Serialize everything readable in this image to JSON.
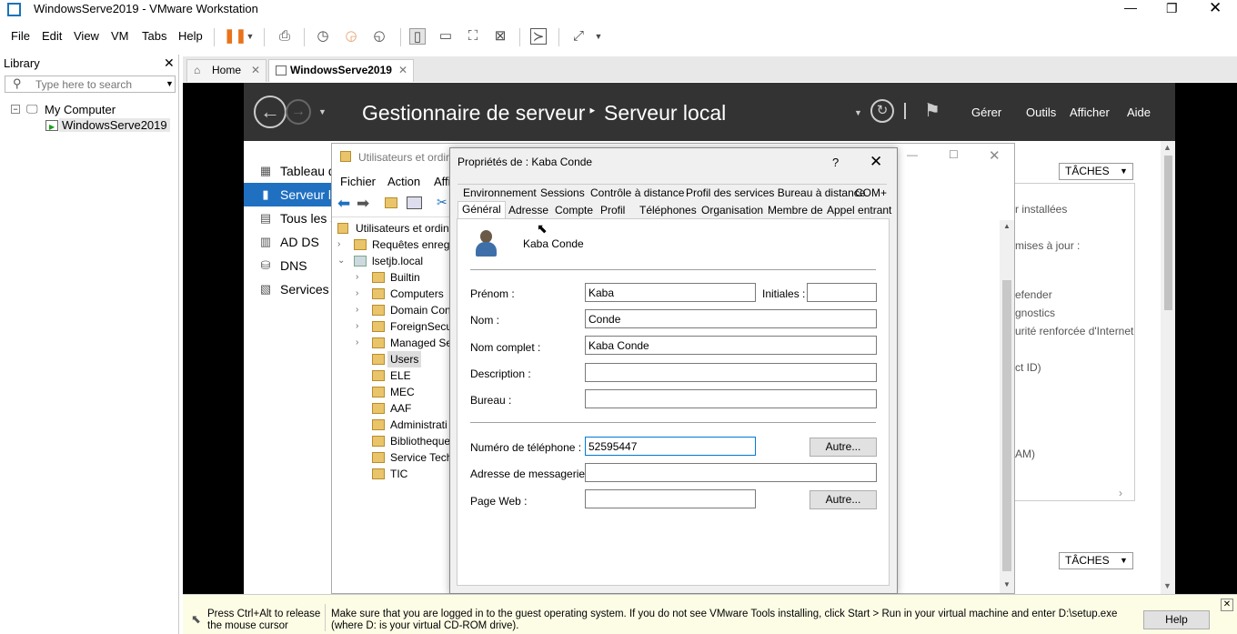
{
  "window": {
    "title": "WindowsServe2019 - VMware Workstation"
  },
  "menubar": {
    "items": [
      "File",
      "Edit",
      "View",
      "VM",
      "Tabs",
      "Help"
    ]
  },
  "library": {
    "title": "Library",
    "search_placeholder": "Type here to search",
    "tree": {
      "root": "My Computer",
      "child": "WindowsServe2019"
    }
  },
  "tabs": [
    {
      "label": "Home"
    },
    {
      "label": "WindowsServe2019"
    }
  ],
  "server_manager": {
    "breadcrumb_root": "Gestionnaire de serveur",
    "breadcrumb_sep": "‣",
    "breadcrumb_page": "Serveur local",
    "menu": [
      "Gérer",
      "Outils",
      "Afficher",
      "Aide"
    ],
    "nav": [
      "Tableau d",
      "Serveur lo",
      "Tous les s",
      "AD DS",
      "DNS",
      "Services d"
    ],
    "tasks_label": "TÂCHES",
    "right_texts": [
      "r installées",
      "mises à jour :",
      "efender",
      "gnostics",
      "urité renforcée d'Internet",
      "ct ID)",
      "AM)"
    ]
  },
  "aduc": {
    "title": "Utilisateurs et ordin",
    "menu": [
      "Fichier",
      "Action",
      "Affi"
    ],
    "tree": {
      "root": "Utilisateurs et ordina",
      "saved": "Requêtes enregi",
      "domain": "lsetjb.local",
      "nodes": [
        "Builtin",
        "Computers",
        "Domain Con",
        "ForeignSecu",
        "Managed Se",
        "Users",
        "ELE",
        "MEC",
        "AAF",
        "Administrati",
        "Bibliotheque",
        "Service Tech",
        "TIC"
      ]
    }
  },
  "dialog": {
    "title": "Propriétés de : Kaba Conde",
    "help": "?",
    "tabs_row1": [
      "Environnement",
      "Sessions",
      "Contrôle à distance",
      "Profil des services Bureau à distance",
      "COM+"
    ],
    "tabs_row2": [
      "Général",
      "Adresse",
      "Compte",
      "Profil",
      "Téléphones",
      "Organisation",
      "Membre de",
      "Appel entrant"
    ],
    "display_name": "Kaba Conde",
    "fields": {
      "prenom_label": "Prénom :",
      "prenom": "Kaba",
      "initiales_label": "Initiales :",
      "initiales": "",
      "nom_label": "Nom :",
      "nom": "Conde",
      "nom_complet_label": "Nom complet :",
      "nom_complet": "Kaba Conde",
      "description_label": "Description :",
      "description": "",
      "bureau_label": "Bureau :",
      "bureau": "",
      "tel_label": "Numéro de téléphone :",
      "tel": "52595447",
      "mail_label": "Adresse de messagerie :",
      "mail": "",
      "web_label": "Page Web :",
      "web": ""
    },
    "autre_label": "Autre..."
  },
  "status": {
    "release": "Press Ctrl+Alt to release the mouse cursor",
    "message": "Make sure that you are logged in to the guest operating system. If you do not see VMware Tools installing, click Start > Run in your virtual machine and enter D:\\setup.exe (where D: is your virtual CD-ROM drive).",
    "help_label": "Help"
  }
}
